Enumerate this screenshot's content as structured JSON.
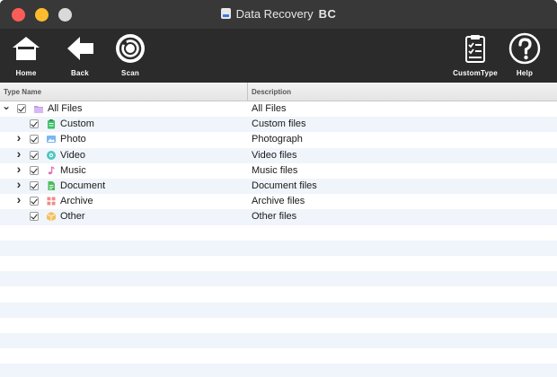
{
  "window": {
    "title": "Data Recovery",
    "edition": "BC"
  },
  "toolbar": {
    "home_label": "Home",
    "back_label": "Back",
    "scan_label": "Scan",
    "custom_type_label": "CustomType",
    "help_label": "Help"
  },
  "table": {
    "columns": [
      "Type Name",
      "Description"
    ],
    "rows": [
      {
        "name": "All Files",
        "description": "All Files",
        "icon": "folder-icon",
        "level": 0,
        "expander": "expanded",
        "checked": true
      },
      {
        "name": "Custom",
        "description": "Custom files",
        "icon": "clipboard-icon",
        "level": 1,
        "expander": "none",
        "checked": true
      },
      {
        "name": "Photo",
        "description": "Photograph",
        "icon": "photo-icon",
        "level": 1,
        "expander": "collapsed",
        "checked": true
      },
      {
        "name": "Video",
        "description": "Video files",
        "icon": "video-icon",
        "level": 1,
        "expander": "collapsed",
        "checked": true
      },
      {
        "name": "Music",
        "description": "Music files",
        "icon": "music-note-icon",
        "level": 1,
        "expander": "collapsed",
        "checked": true
      },
      {
        "name": "Document",
        "description": "Document files",
        "icon": "document-icon",
        "level": 1,
        "expander": "collapsed",
        "checked": true
      },
      {
        "name": "Archive",
        "description": "Archive files",
        "icon": "archive-icon",
        "level": 1,
        "expander": "collapsed",
        "checked": true
      },
      {
        "name": "Other",
        "description": "Other files",
        "icon": "box-icon",
        "level": 1,
        "expander": "none",
        "checked": true
      }
    ]
  },
  "colors": {
    "toolbar_bg": "#2b2b2b",
    "titlebar_bg": "#383838",
    "row_alt": "#f0f5fb"
  }
}
